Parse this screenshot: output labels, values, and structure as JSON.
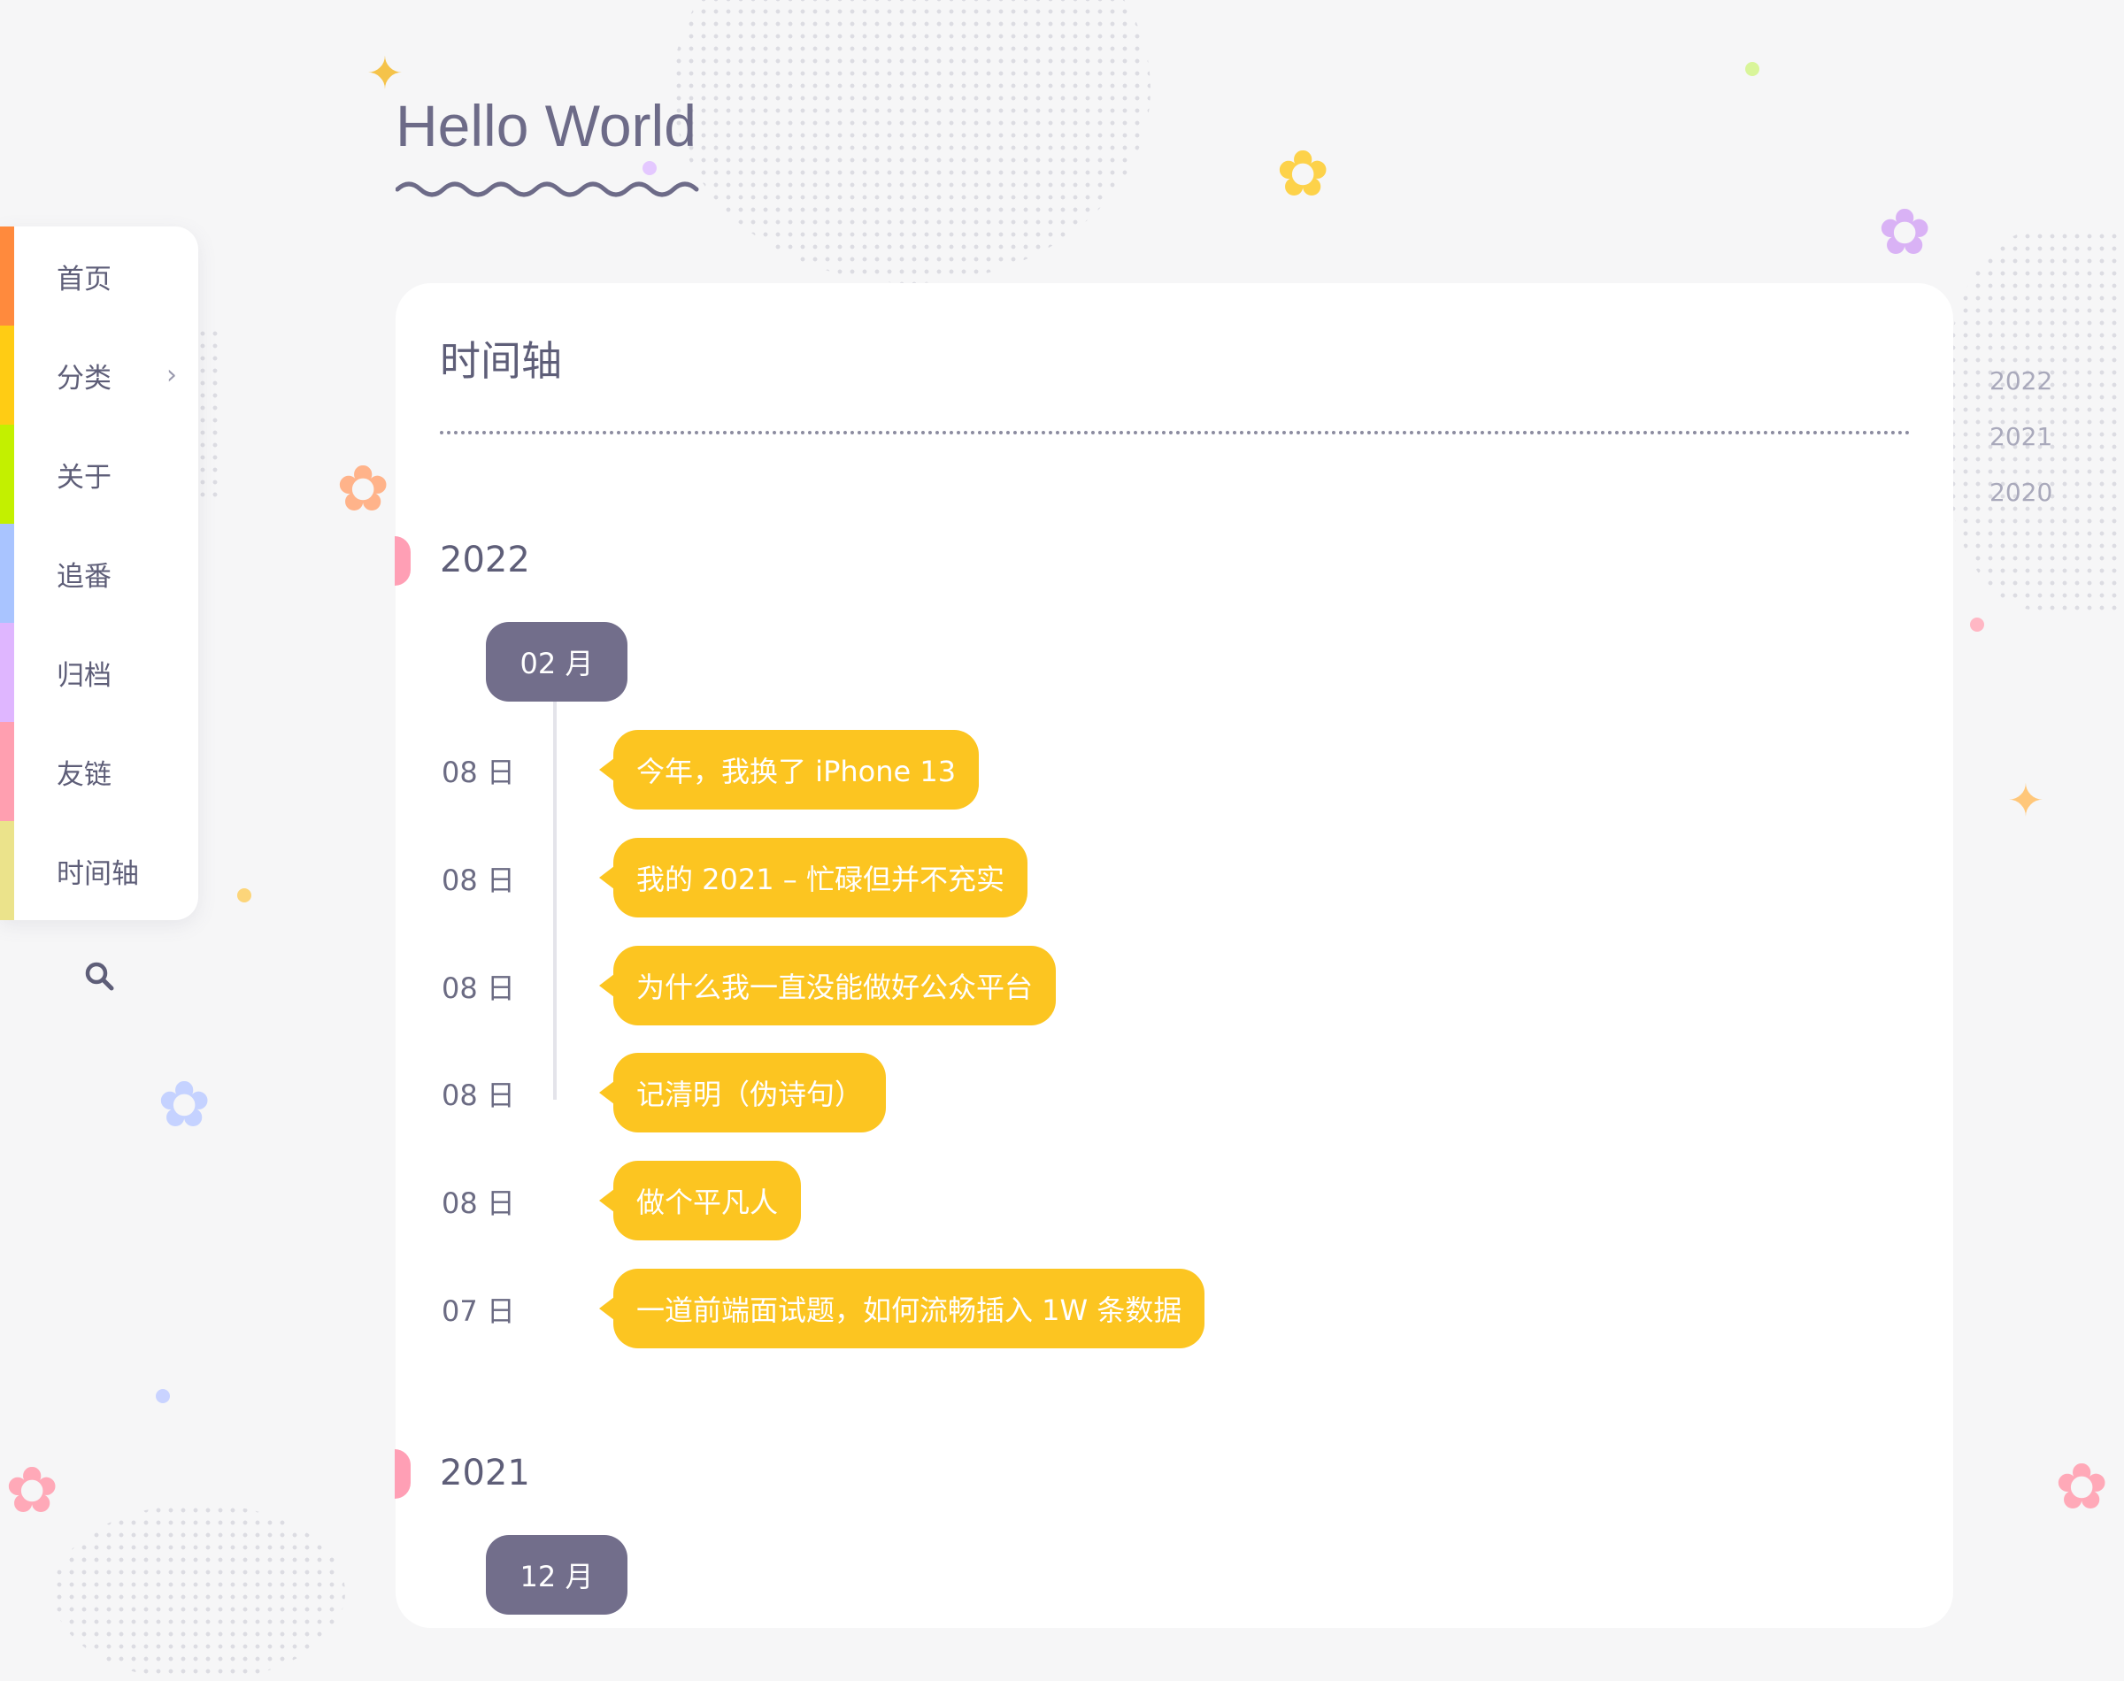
{
  "site": {
    "title": "Hello World"
  },
  "nav": {
    "items": [
      {
        "label": "首页",
        "color": "#ff8a3d"
      },
      {
        "label": "分类",
        "color": "#ffcc14",
        "has_submenu": true
      },
      {
        "label": "关于",
        "color": "#c3f000"
      },
      {
        "label": "追番",
        "color": "#a9c4ff"
      },
      {
        "label": "归档",
        "color": "#dfb6ff"
      },
      {
        "label": "友链",
        "color": "#ff9fb0"
      },
      {
        "label": "时间轴",
        "color": "#ebe38b"
      }
    ],
    "submenu_icon": "chevron-right-icon",
    "search_icon": "search-icon"
  },
  "page": {
    "title": "时间轴",
    "years": [
      {
        "year": "2022",
        "months": [
          {
            "label": "02 月",
            "posts": [
              {
                "day": "08 日",
                "title": "今年，我换了 iPhone 13"
              },
              {
                "day": "08 日",
                "title": "我的 2021 – 忙碌但并不充实"
              },
              {
                "day": "08 日",
                "title": "为什么我一直没能做好公众平台"
              },
              {
                "day": "08 日",
                "title": "记清明（伪诗句）"
              },
              {
                "day": "08 日",
                "title": "做个平凡人"
              },
              {
                "day": "07 日",
                "title": "一道前端面试题，如何流畅插入 1W 条数据"
              }
            ]
          }
        ]
      },
      {
        "year": "2021",
        "months": [
          {
            "label": "12 月",
            "posts": []
          }
        ]
      }
    ]
  },
  "year_index": [
    "2022",
    "2021",
    "2020"
  ],
  "colors": {
    "accent_post": "#fcc521",
    "month_pill": "#726e8b",
    "year_mark": "#ff9fb5"
  }
}
